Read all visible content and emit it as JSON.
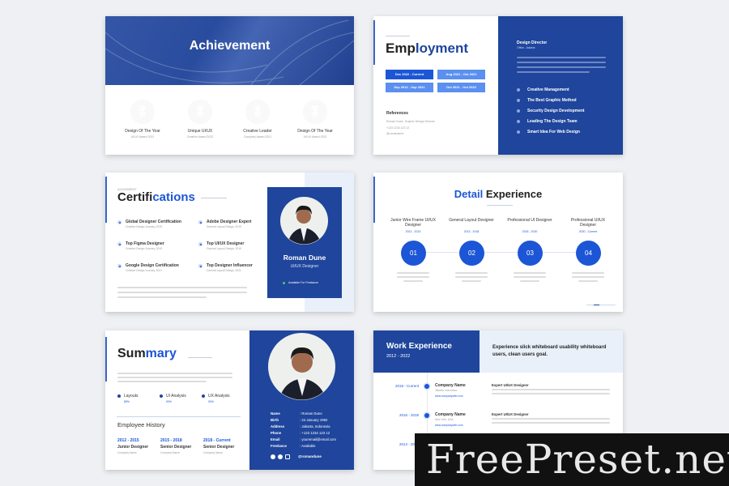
{
  "achievement": {
    "title": "Achievement",
    "items": [
      {
        "label": "Design Of The Year",
        "sub": "UI/UX Award 2021"
      },
      {
        "label": "Unique UI/UX",
        "sub": "Creative Award 2022"
      },
      {
        "label": "Creative Leader",
        "sub": "Company Award 2021"
      },
      {
        "label": "Design Of The Year",
        "sub": "UI/UX Award 2022"
      }
    ]
  },
  "employment": {
    "title_a": "Emp",
    "title_b": "loyment",
    "badges": [
      "Dec 2022 - Current",
      "Aug 2021 - Oct 2021",
      "Sep 2012 - Sep 2021",
      "Oct 2021 - Oct 2022"
    ],
    "references_title": "References",
    "references": [
      "Roman Dune, Graphic Design Director",
      "+123 1234 123 12",
      "@romandune"
    ],
    "role": "Design Director",
    "location": "Office, Jakarta",
    "list": [
      "Creative Management",
      "The Best Graphic Method",
      "Security Design Development",
      "Leading The Design Team",
      "Smart Idea For Web Design"
    ]
  },
  "certifications": {
    "kicker": "ACHIVMENT",
    "title_a": "Certifi",
    "title_b": "cations",
    "items": [
      {
        "label": "Global Designer Certification",
        "sub": "Creative Design Journey, 2019"
      },
      {
        "label": "Adobe Designer Expert",
        "sub": "General Layout Design, 2019"
      },
      {
        "label": "Top Figma Designer",
        "sub": "Creative Design Journey, 2019"
      },
      {
        "label": "Top UI/UX Designer",
        "sub": "General Layout Design, 2019"
      },
      {
        "label": "Google Design Certification",
        "sub": "Creative Design Journey, 2021"
      },
      {
        "label": "Top Designer Influencer",
        "sub": "General Layout Design, 2021"
      }
    ],
    "name": "Roman Dune",
    "role": "UI/UX Designer",
    "status": "Available For Freelance"
  },
  "detail": {
    "title_a": "Detail",
    "title_b": "Experience",
    "steps": [
      {
        "title": "Junior Wire Frame UI/UX Designer",
        "years": "2012 - 2013",
        "num": "01"
      },
      {
        "title": "General Layout Designer",
        "years": "2013 - 2018",
        "num": "02"
      },
      {
        "title": "Professional UI Designer",
        "years": "2018 - 2020",
        "num": "03"
      },
      {
        "title": "Professional UI/UX Designer",
        "years": "2020 - Current",
        "num": "04"
      }
    ]
  },
  "summary": {
    "title_a": "Sum",
    "title_b": "mary",
    "skills": [
      {
        "label": "Layouts",
        "value": "85%"
      },
      {
        "label": "UI Analysis",
        "value": "90%"
      },
      {
        "label": "UX Analysis",
        "value": "90%"
      }
    ],
    "history_title": "Employee History",
    "history": [
      {
        "years": "2012 - 2015",
        "role": "Junior Designer",
        "company": "Company Name"
      },
      {
        "years": "2015 - 2018",
        "role": "Senior Designer",
        "company": "Company Name"
      },
      {
        "years": "2018 - Current",
        "role": "Senior Designer",
        "company": "Company Name"
      }
    ],
    "profile": [
      [
        "Name",
        ": Roman Dune"
      ],
      [
        "Birth",
        ": 24 January 1992"
      ],
      [
        "Address",
        ": Jakarta, Indonesia"
      ],
      [
        "Phone",
        ": +123 1234 123 12"
      ],
      [
        "Email",
        ": youremail@email.com"
      ],
      [
        "Freelance",
        ": Available"
      ]
    ],
    "handle": "@romandune"
  },
  "work": {
    "title": "Work Experience",
    "years": "2012 - 2022",
    "tagline": "Experience slick whiteboard usability whiteboard users, clean users goal.",
    "rows": [
      {
        "period": "2018 - Current",
        "company": "Company Name",
        "location": "Jakarta, Indonesia",
        "site": "www.companyweb.com",
        "role": "Expert UI/UX Designer"
      },
      {
        "period": "2016 - 2018",
        "company": "Company Name",
        "location": "New York, USA",
        "site": "www.companyweb.com",
        "role": "Expert UI/UX Designer"
      },
      {
        "period": "2014 - 2016"
      }
    ]
  },
  "watermark": "FreePreset.net",
  "colors": {
    "primary": "#1f459c",
    "accent": "#1c56d6"
  }
}
